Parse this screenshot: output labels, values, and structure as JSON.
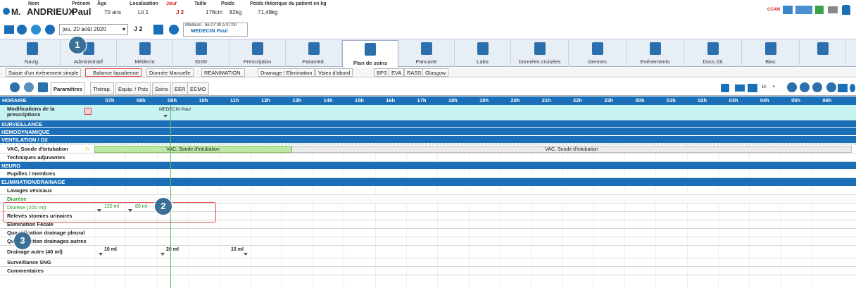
{
  "patient": {
    "nom_label": "Nom",
    "prenom_label": "Prénom",
    "age_label": "Âge",
    "localisation_label": "Localisation",
    "jour_label": "Jour",
    "taille_label": "Taille",
    "poids_label": "Poids",
    "poids_theo_label": "Poids théorique du patient en kg",
    "civilite": "M.",
    "nom": "ANDRIEUX",
    "prenom": "Paul",
    "age": "70 ans",
    "lit": "Lit 1",
    "jour": "J 2",
    "taille": "176cm",
    "poids": "82kg",
    "poids_theo": "71,48kg"
  },
  "nav": {
    "date": "jeu. 20 août 2020",
    "day": "J 2",
    "medecin_line1": "Médecin - de 07:00 à 07:00",
    "medecin_name": "MEDECIN Paul"
  },
  "header_right": {
    "ccam": "CCAM"
  },
  "toolbar": [
    {
      "label": "Navig.",
      "icon": "list-icon"
    },
    {
      "label": "Administratif",
      "icon": "id-card-icon"
    },
    {
      "label": "Médecin",
      "icon": "doctor-icon"
    },
    {
      "label": "IGSII",
      "icon": "document-icon"
    },
    {
      "label": "Prescription",
      "icon": "pill-icon"
    },
    {
      "label": "Paramed.",
      "icon": "nurse-icon"
    },
    {
      "label": "Plan de soins",
      "icon": "grid-icon"
    },
    {
      "label": "Pancarte",
      "icon": "chart-icon"
    },
    {
      "label": "Labo",
      "icon": "microscope-icon"
    },
    {
      "label": "Données croisées",
      "icon": "chart-icon"
    },
    {
      "label": "Germes",
      "icon": "germ-icon"
    },
    {
      "label": "Evénements",
      "icon": "list-icon"
    },
    {
      "label": "Docs (0)",
      "icon": "docs-icon"
    },
    {
      "label": "Bloc",
      "icon": "bed-icon"
    },
    {
      "label": "",
      "icon": "wrench-icon"
    }
  ],
  "actions": {
    "saisie": "Saisie d'un événement simple",
    "balance": "Balance liquidienne",
    "donnee": "Donnée Manuelle",
    "reanimation": "REANIMATION.",
    "drainage": "Drainage / Elimination",
    "voies": "Voies d'abord",
    "bps": "BPS",
    "eva": "EVA",
    "rass": "RASS",
    "glasgow": "Glasgow"
  },
  "tabs": [
    "Paramètres",
    "Thérap.",
    "Equip. / Psts",
    "Soins",
    "EER",
    "ECMO"
  ],
  "zoom_label": "1h",
  "grid": {
    "horaire": "HORAIRE",
    "hours": [
      "07h",
      "08h",
      "09h",
      "10h",
      "11h",
      "12h",
      "13h",
      "14h",
      "15h",
      "16h",
      "17h",
      "18h",
      "19h",
      "20h",
      "21h",
      "22h",
      "23h",
      "00h",
      "01h",
      "02h",
      "03h",
      "04h",
      "05h",
      "06h"
    ],
    "rows": {
      "modif": "Modifications de la prescriptions",
      "modif_who": "MEDECIN Paul",
      "surveillance": "SURVEILLANCE",
      "hemo": "HEMODYNAMIQUE",
      "ventil": "VENTILATION / O2",
      "vac": "VAC, Sonde d'intubation",
      "vac_bar": "VAC, Sonde d'intubation",
      "vac_bar2": "VAC, Sonde d'intubation",
      "techniques": "Techniques adjuvantes",
      "neuro": "NEURO",
      "pupilles": "Pupilles / membres",
      "elim": "ELIMINATION/DRAINAGE",
      "lavages": "Lavages vésicaux",
      "diurese": "Diurèse",
      "diurese_sub": "Diurèse (200 ml)",
      "d1": "120 ml",
      "d2": "80 ml",
      "releves": "Relevés stomies urinaires",
      "elimination": "Elimination Fécale",
      "quantif_pleural": "Quantification drainage pleural",
      "quantif_autres": "Quantifiaction drainages autres",
      "drainage_autre": "Drainage autre (40 ml)",
      "dr1": "10 ml",
      "dr2": "20 ml",
      "dr3": "10 ml",
      "sng": "Surveillance SNG",
      "commentaires": "Commentaires"
    }
  },
  "callouts": [
    "1",
    "2",
    "3"
  ]
}
